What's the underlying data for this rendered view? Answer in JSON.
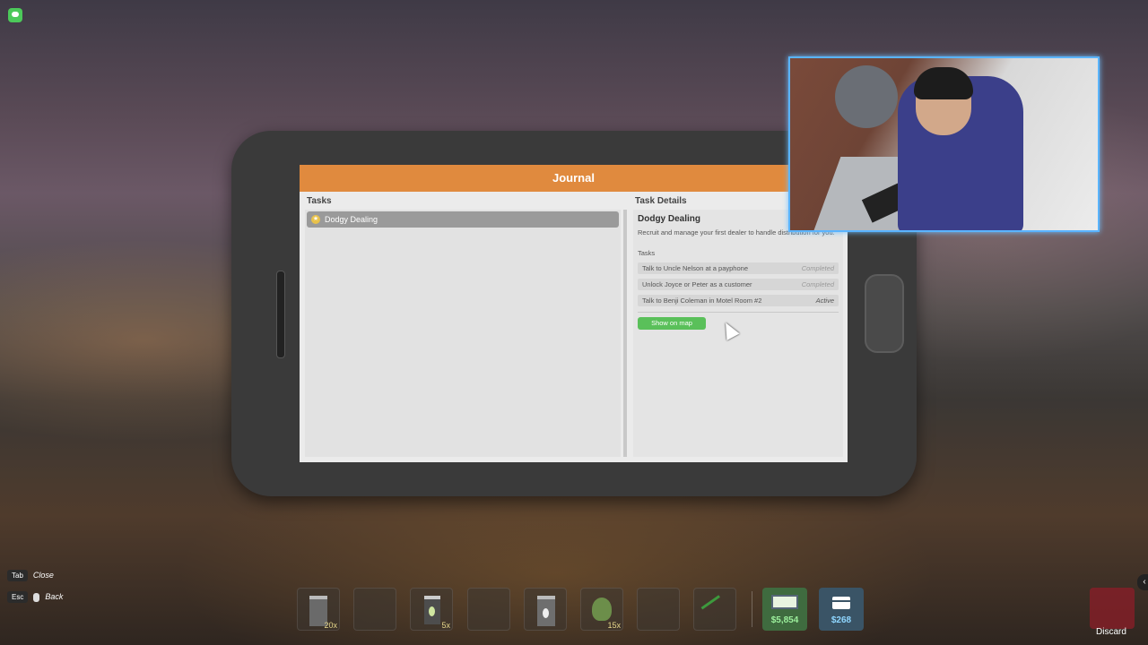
{
  "journal": {
    "title": "Journal",
    "tasks_header": "Tasks",
    "details_header": "Task Details",
    "task_list": [
      {
        "label": "Dodgy Dealing",
        "selected": true
      }
    ],
    "details": {
      "title": "Dodgy Dealing",
      "description": "Recruit and manage your first dealer to handle distribution for you.",
      "subtasks_label": "Tasks",
      "subtasks": [
        {
          "name": "Talk to Uncle Nelson at a payphone",
          "status": "Completed"
        },
        {
          "name": "Unlock Joyce or Peter as a customer",
          "status": "Completed"
        },
        {
          "name": "Talk to Benji Coleman in Motel Room #2",
          "status": "Active"
        }
      ],
      "map_button": "Show on map"
    }
  },
  "controls": [
    {
      "key": "Tab",
      "action": "Close"
    },
    {
      "key": "Esc",
      "action": "Back"
    }
  ],
  "hotbar": [
    {
      "icon": "packaging-bag-icon",
      "qty": "20x"
    },
    {
      "icon": "",
      "qty": ""
    },
    {
      "icon": "jar-icon",
      "qty": "5x"
    },
    {
      "icon": "",
      "qty": ""
    },
    {
      "icon": "baggie-icon",
      "qty": ""
    },
    {
      "icon": "leaf-icon",
      "qty": "15x"
    },
    {
      "icon": "",
      "qty": ""
    },
    {
      "icon": "trimmers-icon",
      "qty": ""
    }
  ],
  "cash": "$5,854",
  "bank": "$268",
  "discard": "Discard",
  "colors": {
    "journal_header": "#e08a3e",
    "map_button": "#5ac05a"
  }
}
